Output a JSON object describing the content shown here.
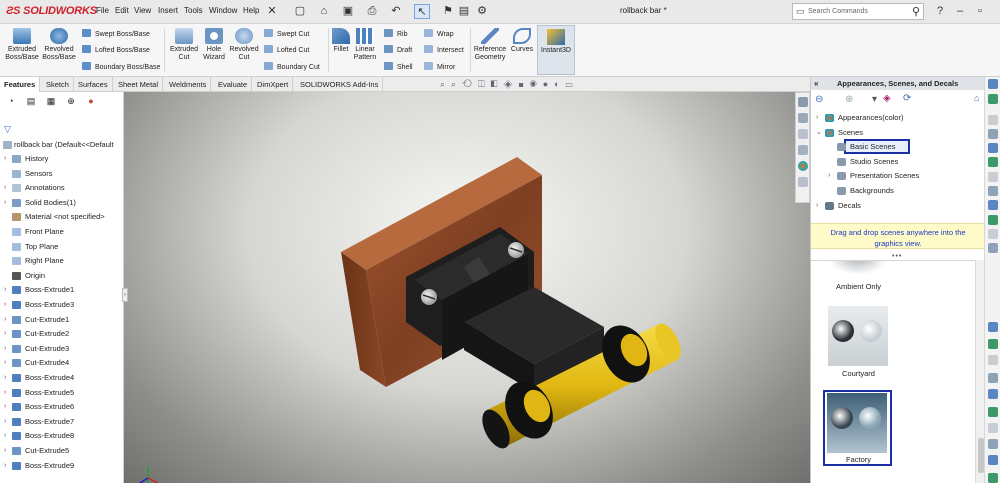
{
  "app": {
    "logo_text": "SOLIDWORKS",
    "document_title": "rollback bar *"
  },
  "menu": [
    "File",
    "Edit",
    "View",
    "Insert",
    "Tools",
    "Window",
    "Help"
  ],
  "search": {
    "placeholder": "Search Commands"
  },
  "ribbon": {
    "extruded_boss": "Extruded\nBoss/Base",
    "revolved_boss": "Revolved\nBoss/Base",
    "swept_boss": "Swept Boss/Base",
    "lofted_boss": "Lofted Boss/Base",
    "boundary_boss": "Boundary Boss/Base",
    "extruded_cut": "Extruded\nCut",
    "hole_wizard": "Hole\nWizard",
    "revolved_cut": "Revolved\nCut",
    "swept_cut": "Swept Cut",
    "lofted_cut": "Lofted Cut",
    "boundary_cut": "Boundary Cut",
    "fillet": "Fillet",
    "linear_pattern": "Linear\nPattern",
    "rib": "Rib",
    "draft": "Draft",
    "shell": "Shell",
    "wrap": "Wrap",
    "intersect": "Intersect",
    "mirror": "Mirror",
    "reference_geometry": "Reference\nGeometry",
    "curves": "Curves",
    "instant3d": "Instant3D"
  },
  "tabs": [
    "Features",
    "Sketch",
    "Surfaces",
    "Sheet Metal",
    "Weldments",
    "Evaluate",
    "DimXpert",
    "SOLIDWORKS Add-Ins"
  ],
  "active_tab": "Features",
  "feature_tree": {
    "root": "rollback bar  (Default<<Default",
    "items": [
      {
        "label": "History",
        "icon": "history-icon",
        "expandable": true
      },
      {
        "label": "Sensors",
        "icon": "sensors-icon",
        "expandable": false
      },
      {
        "label": "Annotations",
        "icon": "annotations-icon",
        "expandable": true
      },
      {
        "label": "Solid Bodies(1)",
        "icon": "solid-bodies-icon",
        "expandable": true
      },
      {
        "label": "Material <not specified>",
        "icon": "material-icon",
        "expandable": false
      },
      {
        "label": "Front Plane",
        "icon": "plane-icon",
        "expandable": false
      },
      {
        "label": "Top Plane",
        "icon": "plane-icon",
        "expandable": false
      },
      {
        "label": "Right Plane",
        "icon": "plane-icon",
        "expandable": false
      },
      {
        "label": "Origin",
        "icon": "origin-icon",
        "expandable": false
      },
      {
        "label": "Boss-Extrude1",
        "icon": "extrude-icon",
        "expandable": true
      },
      {
        "label": "Boss-Extrude3",
        "icon": "extrude-icon",
        "expandable": true
      },
      {
        "label": "Cut-Extrude1",
        "icon": "cut-icon",
        "expandable": true
      },
      {
        "label": "Cut-Extrude2",
        "icon": "cut-icon",
        "expandable": true
      },
      {
        "label": "Cut-Extrude3",
        "icon": "cut-icon",
        "expandable": true
      },
      {
        "label": "Cut-Extrude4",
        "icon": "cut-icon",
        "expandable": true
      },
      {
        "label": "Boss-Extrude4",
        "icon": "extrude-icon",
        "expandable": true
      },
      {
        "label": "Boss-Extrude5",
        "icon": "extrude-icon",
        "expandable": true
      },
      {
        "label": "Boss-Extrude6",
        "icon": "extrude-icon",
        "expandable": true
      },
      {
        "label": "Boss-Extrude7",
        "icon": "extrude-icon",
        "expandable": true
      },
      {
        "label": "Boss-Extrude8",
        "icon": "extrude-icon",
        "expandable": true
      },
      {
        "label": "Cut-Extrude5",
        "icon": "cut-icon",
        "expandable": true
      },
      {
        "label": "Boss-Extrude9",
        "icon": "extrude-icon",
        "expandable": true
      }
    ]
  },
  "task_pane": {
    "title": "Appearances, Scenes, and Decals",
    "tree": [
      {
        "label": "Appearances(color)",
        "level": 0,
        "expand": ">"
      },
      {
        "label": "Scenes",
        "level": 0,
        "expand": "v"
      },
      {
        "label": "Basic Scenes",
        "level": 1,
        "expand": "",
        "selected": true
      },
      {
        "label": "Studio Scenes",
        "level": 1,
        "expand": ""
      },
      {
        "label": "Presentation Scenes",
        "level": 1,
        "expand": ">"
      },
      {
        "label": "Backgrounds",
        "level": 1,
        "expand": ""
      },
      {
        "label": "Decals",
        "level": 0,
        "expand": ">"
      }
    ],
    "tip": "Drag and drop scenes anywhere into the\ngraphics view.",
    "scenes": [
      "Ambient Only",
      "Courtyard",
      "Factory"
    ],
    "selected_scene": "Factory"
  },
  "colors": {
    "accent": "#1a2fa3",
    "brand": "#d0202a",
    "wood": "#8a4a2a",
    "roller": "#e8c21a"
  }
}
